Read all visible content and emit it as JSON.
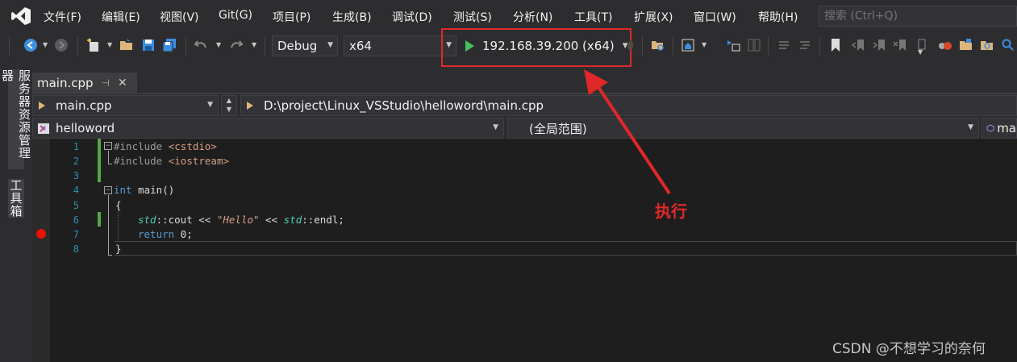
{
  "menu": {
    "items": [
      "文件(F)",
      "编辑(E)",
      "视图(V)",
      "Git(G)",
      "项目(P)",
      "生成(B)",
      "调试(D)",
      "测试(S)",
      "分析(N)",
      "工具(T)",
      "扩展(X)",
      "窗口(W)",
      "帮助(H)"
    ],
    "search_placeholder": "搜索 (Ctrl+Q)"
  },
  "toolbar": {
    "configuration": "Debug",
    "platform": "x64",
    "run_target": "192.168.39.200 (x64)"
  },
  "side_tabs": [
    "服务器资源管理器",
    "工具箱"
  ],
  "document_tab": {
    "label": "main.cpp"
  },
  "navbar": {
    "file": "main.cpp",
    "path": "D:\\project\\Linux_VSStudio\\helloword\\main.cpp",
    "project": "helloword",
    "scope": "(全局范围)",
    "member": "ma"
  },
  "editor": {
    "line_numbers": [
      "1",
      "2",
      "3",
      "4",
      "5",
      "6",
      "7",
      "8"
    ],
    "code": {
      "l1_dir": "#include",
      "l1_hdr": "<cstdio>",
      "l2_dir": "#include",
      "l2_hdr": "<iostream>",
      "l4_type": "int",
      "l4_rest": " main()",
      "l5": "{",
      "l6_ns1": "std",
      "l6_mid": "::cout << ",
      "l6_str": "\"Hello\"",
      "l6_mid2": " << ",
      "l6_ns2": "std",
      "l6_end": "::endl;",
      "l7_kw": "return",
      "l7_rest": " 0;",
      "l8": "}"
    }
  },
  "annotation": {
    "label": "执行",
    "color": "#e02828"
  },
  "watermark": "CSDN @不想学习的奈何",
  "colors": {
    "accent_run": "#45c15d",
    "breakpoint": "#e51400",
    "annotation": "#e02828"
  }
}
